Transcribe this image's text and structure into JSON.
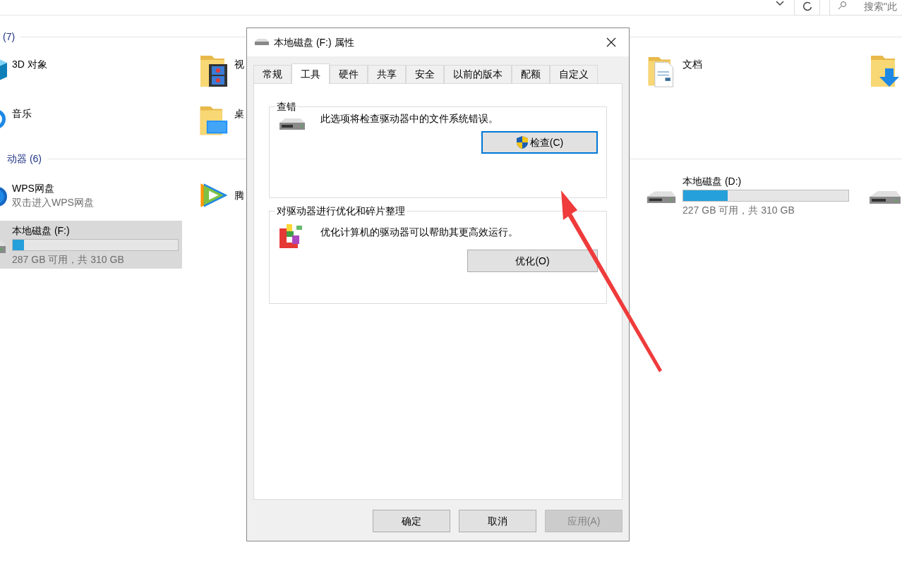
{
  "toolbar": {
    "search_placeholder": "搜索\"此"
  },
  "sections": [
    {
      "header": "(7)",
      "items": [
        {
          "kind": "objects3d",
          "label": "3D 对象",
          "selected": false
        },
        {
          "kind": "videos",
          "label": "视",
          "selected": false
        },
        {
          "kind": "documents",
          "label": "文档",
          "selected": false
        },
        {
          "kind": "downloads",
          "selected": false
        },
        {
          "kind": "music",
          "label": "音乐",
          "selected": false
        },
        {
          "kind": "desktop",
          "label": "桌",
          "selected": false
        }
      ]
    },
    {
      "header": "动器 (6)",
      "items": [
        {
          "kind": "cloud",
          "label": "WPS网盘",
          "subtitle": "双击进入WPS网盘",
          "selected": false
        },
        {
          "kind": "player",
          "label": "腾",
          "selected": false
        },
        {
          "kind": "drive",
          "label": "本地磁盘 (D:)",
          "level": 0.27,
          "subtitle": "227 GB 可用，共 310 GB",
          "selected": false
        },
        {
          "kind": "drive",
          "selected": false
        },
        {
          "kind": "drive",
          "label": "本地磁盘 (F:)",
          "level": 0.07,
          "subtitle": "287 GB 可用，共 310 GB",
          "selected": true
        }
      ]
    }
  ],
  "dialog": {
    "title": "本地磁盘 (F:) 属性",
    "tabs": [
      {
        "label": "常规",
        "selected": false
      },
      {
        "label": "工具",
        "selected": true
      },
      {
        "label": "硬件",
        "selected": false
      },
      {
        "label": "共享",
        "selected": false
      },
      {
        "label": "安全",
        "selected": false
      },
      {
        "label": "以前的版本",
        "selected": false
      },
      {
        "label": "配额",
        "selected": false
      },
      {
        "label": "自定义",
        "selected": false
      }
    ],
    "groups": [
      {
        "kind": "check",
        "title": "查错",
        "description": "此选项将检查驱动器中的文件系统错误。",
        "button": {
          "label": "检查(C)",
          "focused": true
        }
      },
      {
        "kind": "optimize",
        "title": "对驱动器进行优化和碎片整理",
        "description": "优化计算机的驱动器可以帮助其更高效运行。",
        "button": {
          "label": "优化(O)",
          "focused": false
        }
      }
    ],
    "buttons": [
      {
        "label": "确定",
        "disabled": false
      },
      {
        "label": "取消",
        "disabled": false
      },
      {
        "label": "应用(A)",
        "disabled": true
      }
    ]
  }
}
